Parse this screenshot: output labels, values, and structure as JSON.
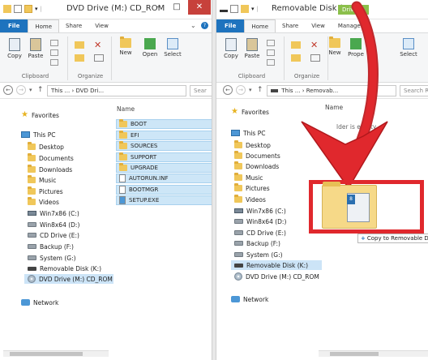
{
  "left": {
    "title": "DVD Drive (M:) CD_ROM",
    "tabs": {
      "file": "File",
      "home": "Home",
      "share": "Share",
      "view": "View"
    },
    "ribbon": {
      "copy": "Copy",
      "paste": "Paste",
      "clipboard": "Clipboard",
      "organize": "Organize",
      "new": "New",
      "open": "Open",
      "select": "Select"
    },
    "address": {
      "path1": "This ...",
      "path2": "DVD Dri...",
      "search": "Sear"
    },
    "column_name": "Name",
    "nav": {
      "favorites": "Favorites",
      "this_pc": "This PC",
      "desktop": "Desktop",
      "documents": "Documents",
      "downloads": "Downloads",
      "music": "Music",
      "pictures": "Pictures",
      "videos": "Videos",
      "win7": "Win7x86 (C:)",
      "win8": "Win8x64 (D:)",
      "cd": "CD Drive (E:)",
      "backup": "Backup (F:)",
      "system": "System (G:)",
      "removable": "Removable Disk (K:)",
      "dvd": "DVD Drive (M:) CD_ROM",
      "network": "Network"
    },
    "files": [
      "BOOT",
      "EFI",
      "SOURCES",
      "SUPPORT",
      "UPGRADE",
      "AUTORUN.INF",
      "BOOTMGR",
      "SETUP.EXE"
    ]
  },
  "right": {
    "title": "Removable Disk (",
    "drive_badge": "Drive ...",
    "tabs": {
      "file": "File",
      "home": "Home",
      "share": "Share",
      "view": "View",
      "manage": "Manage"
    },
    "ribbon": {
      "copy": "Copy",
      "paste": "Paste",
      "clipboard": "Clipboard",
      "organize": "Organize",
      "new": "New",
      "properties": "Prope",
      "select": "Select"
    },
    "address": {
      "path1": "This ...",
      "path2": "Removab...",
      "search": "Search R"
    },
    "column_name": "Name",
    "empty": "lder is empty.",
    "nav": {
      "favorites": "Favorites",
      "this_pc": "This PC",
      "desktop": "Desktop",
      "documents": "Documents",
      "downloads": "Downloads",
      "music": "Music",
      "pictures": "Pictures",
      "videos": "Videos",
      "win7": "Win7x86 (C:)",
      "win8": "Win8x64 (D:)",
      "cd": "CD Drive (E:)",
      "backup": "Backup (F:)",
      "system": "System (G:)",
      "removable": "Removable Disk (K:)",
      "dvd": "DVD Drive (M:) CD_ROM",
      "network": "Network"
    }
  },
  "drag": {
    "tooltip": "Copy to Removable D",
    "badge": "8"
  },
  "colors": {
    "accent": "#1e73be",
    "highlight": "#cde6f7",
    "arrow": "#e0282d",
    "close": "#c7413b"
  }
}
